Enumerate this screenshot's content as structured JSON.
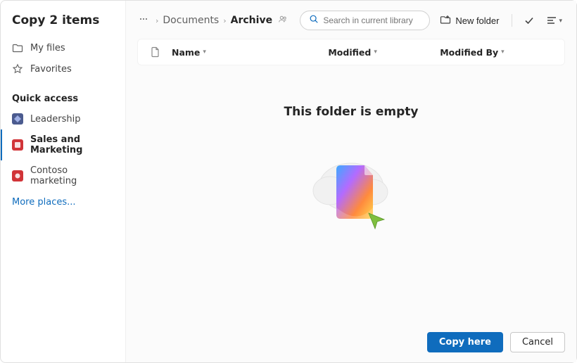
{
  "dialog": {
    "title": "Copy 2 items"
  },
  "sidebar": {
    "myfiles_label": "My files",
    "favorites_label": "Favorites",
    "quick_access_header": "Quick access",
    "items": [
      {
        "label": "Leadership",
        "color": "#4b5b8f"
      },
      {
        "label": "Sales and Marketing",
        "color": "#d13438"
      },
      {
        "label": "Contoso marketing",
        "color": "#d13438"
      }
    ],
    "more_places": "More places..."
  },
  "toolbar": {
    "breadcrumb": {
      "parent": "Documents",
      "current": "Archive"
    },
    "search_placeholder": "Search in current library",
    "new_folder_label": "New folder"
  },
  "columns": {
    "name": "Name",
    "modified": "Modified",
    "modified_by": "Modified By"
  },
  "empty": {
    "title": "This folder is empty"
  },
  "footer": {
    "primary": "Copy here",
    "cancel": "Cancel"
  }
}
